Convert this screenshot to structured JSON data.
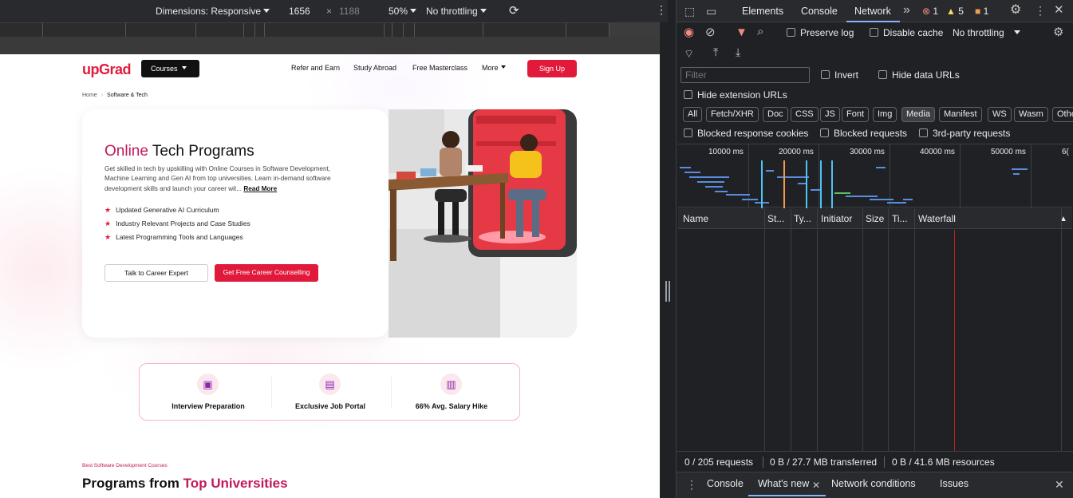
{
  "device_toolbar": {
    "dimensions_label": "Dimensions: Responsive",
    "width_value": "1656",
    "times": "×",
    "height_placeholder": "1188",
    "zoom": "50%",
    "throttling": "No throttling"
  },
  "page": {
    "logo": "upGrad",
    "courses_label": "Courses",
    "nav": [
      "Refer and Earn",
      "Study Abroad",
      "Free Masterclass",
      "More"
    ],
    "signup_label": "Sign Up",
    "breadcrumb": {
      "home": "Home",
      "current": "Software & Tech"
    },
    "hero": {
      "title_accent": "Online",
      "title_rest": " Tech Programs",
      "description": "Get skilled in tech by upskilling with Online Courses in Software Development, Machine Learning and Gen AI from top universities. Learn in-demand software development skills and launch your career wit...",
      "read_more": "Read More",
      "bullets": [
        "Updated Generative AI Curriculum",
        "Industry Relevant Projects and Case Studies",
        "Latest Programming Tools and Languages"
      ],
      "talk_button": "Talk to Career Expert",
      "free_button": "Get Free Career Counselling"
    },
    "features": [
      "Interview Preparation",
      "Exclusive Job Portal",
      "66% Avg. Salary Hike"
    ],
    "section_eyebrow": "Best Software Development Courses",
    "section_heading_rest": "Programs from ",
    "section_heading_accent": "Top Universities"
  },
  "devtools": {
    "tabs": [
      "Elements",
      "Console",
      "Network"
    ],
    "active_tab": "Network",
    "errors": "1",
    "warnings": "5",
    "issues": "1",
    "preserve_log": "Preserve log",
    "disable_cache": "Disable cache",
    "throttling": "No throttling",
    "filter_placeholder": "Filter",
    "invert": "Invert",
    "hide_data_urls": "Hide data URLs",
    "hide_extension_urls": "Hide extension URLs",
    "type_filters": [
      "All",
      "Fetch/XHR",
      "Doc",
      "CSS",
      "JS",
      "Font",
      "Img",
      "Media",
      "Manifest",
      "WS",
      "Wasm",
      "Othe"
    ],
    "active_type": "Media",
    "blocked_cookies": "Blocked response cookies",
    "blocked_requests": "Blocked requests",
    "third_party": "3rd-party requests",
    "overview_ticks": [
      "10000 ms",
      "20000 ms",
      "30000 ms",
      "40000 ms",
      "50000 ms",
      "6("
    ],
    "columns": [
      "Name",
      "St...",
      "Ty...",
      "Initiator",
      "Size",
      "Ti...",
      "Waterfall"
    ],
    "status": {
      "requests": "0 / 205 requests",
      "transferred": "0 B / 27.7 MB transferred",
      "resources": "0 B / 41.6 MB resources"
    },
    "drawer_tabs": [
      "Console",
      "What's new",
      "Network conditions",
      "Issues"
    ],
    "active_drawer_tab": "What's new"
  }
}
